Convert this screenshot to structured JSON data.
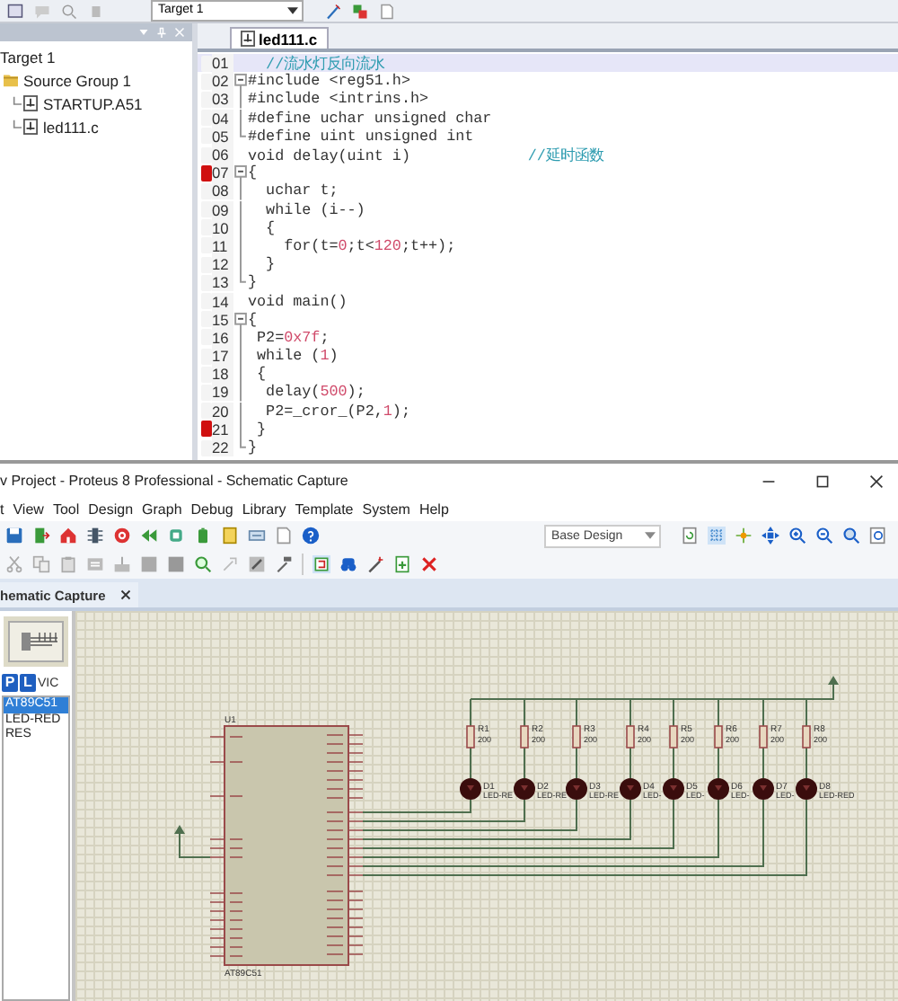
{
  "keil": {
    "target_select": "Target 1",
    "project_tree": [
      {
        "label": "Target 1",
        "children": [
          {
            "label": "Source Group 1",
            "kind": "folder",
            "children": [
              {
                "label": "STARTUP.A51",
                "kind": "file"
              },
              {
                "label": "led111.c",
                "kind": "file"
              }
            ]
          }
        ]
      }
    ],
    "editor": {
      "tab": "led111.c",
      "lines": [
        {
          "num": "01",
          "highlighted": true,
          "breakpoint": false,
          "kind": "plain",
          "segments": [
            {
              "kind": "comment",
              "text": "  //流水灯反向流水"
            }
          ]
        },
        {
          "num": "02",
          "highlighted": false,
          "breakpoint": false,
          "kind": "open",
          "segments": [
            {
              "kind": "code",
              "text": "#include <reg51.h>"
            }
          ]
        },
        {
          "num": "03",
          "highlighted": false,
          "breakpoint": false,
          "kind": "inner",
          "segments": [
            {
              "kind": "code",
              "text": "#include <intrins.h>"
            }
          ]
        },
        {
          "num": "04",
          "highlighted": false,
          "breakpoint": false,
          "kind": "inner",
          "segments": [
            {
              "kind": "code",
              "text": "#define uchar unsigned char"
            }
          ]
        },
        {
          "num": "05",
          "highlighted": false,
          "breakpoint": false,
          "kind": "close",
          "segments": [
            {
              "kind": "code",
              "text": "#define uint unsigned int"
            }
          ]
        },
        {
          "num": "06",
          "highlighted": false,
          "breakpoint": false,
          "kind": "plain",
          "segments": [
            {
              "kind": "code",
              "text": "void delay(uint i)             "
            },
            {
              "kind": "comment",
              "text": "//延时函数"
            }
          ]
        },
        {
          "num": "07",
          "highlighted": false,
          "breakpoint": true,
          "kind": "open",
          "segments": [
            {
              "kind": "code",
              "text": "{"
            }
          ]
        },
        {
          "num": "08",
          "highlighted": false,
          "breakpoint": false,
          "kind": "inner",
          "segments": [
            {
              "kind": "code",
              "text": "  uchar t;"
            }
          ]
        },
        {
          "num": "09",
          "highlighted": false,
          "breakpoint": false,
          "kind": "inner",
          "segments": [
            {
              "kind": "code",
              "text": "  while (i--)"
            }
          ]
        },
        {
          "num": "10",
          "highlighted": false,
          "breakpoint": false,
          "kind": "inner",
          "segments": [
            {
              "kind": "code",
              "text": "  {"
            }
          ]
        },
        {
          "num": "11",
          "highlighted": false,
          "breakpoint": false,
          "kind": "inner",
          "segments": [
            {
              "kind": "code",
              "text": "    for(t="
            },
            {
              "kind": "number",
              "text": "0"
            },
            {
              "kind": "code",
              "text": ";t<"
            },
            {
              "kind": "number",
              "text": "120"
            },
            {
              "kind": "code",
              "text": ";t++);"
            }
          ]
        },
        {
          "num": "12",
          "highlighted": false,
          "breakpoint": false,
          "kind": "inner",
          "segments": [
            {
              "kind": "code",
              "text": "  }"
            }
          ]
        },
        {
          "num": "13",
          "highlighted": false,
          "breakpoint": false,
          "kind": "close",
          "segments": [
            {
              "kind": "code",
              "text": "}"
            }
          ]
        },
        {
          "num": "14",
          "highlighted": false,
          "breakpoint": false,
          "kind": "plain",
          "segments": [
            {
              "kind": "code",
              "text": "void main()"
            }
          ]
        },
        {
          "num": "15",
          "highlighted": false,
          "breakpoint": false,
          "kind": "open",
          "segments": [
            {
              "kind": "code",
              "text": "{"
            }
          ]
        },
        {
          "num": "16",
          "highlighted": false,
          "breakpoint": false,
          "kind": "inner",
          "segments": [
            {
              "kind": "code",
              "text": " P2="
            },
            {
              "kind": "number",
              "text": "0x7f"
            },
            {
              "kind": "code",
              "text": ";"
            }
          ]
        },
        {
          "num": "17",
          "highlighted": false,
          "breakpoint": false,
          "kind": "inner",
          "segments": [
            {
              "kind": "code",
              "text": " while ("
            },
            {
              "kind": "number",
              "text": "1"
            },
            {
              "kind": "code",
              "text": ")"
            }
          ]
        },
        {
          "num": "18",
          "highlighted": false,
          "breakpoint": false,
          "kind": "inner",
          "segments": [
            {
              "kind": "code",
              "text": " {"
            }
          ]
        },
        {
          "num": "19",
          "highlighted": false,
          "breakpoint": false,
          "kind": "inner",
          "segments": [
            {
              "kind": "code",
              "text": "  delay("
            },
            {
              "kind": "number",
              "text": "500"
            },
            {
              "kind": "code",
              "text": ");"
            }
          ]
        },
        {
          "num": "20",
          "highlighted": false,
          "breakpoint": false,
          "kind": "inner",
          "segments": [
            {
              "kind": "code",
              "text": "  P2=_cror_(P2,"
            },
            {
              "kind": "number",
              "text": "1"
            },
            {
              "kind": "code",
              "text": ");"
            }
          ]
        },
        {
          "num": "21",
          "highlighted": false,
          "breakpoint": true,
          "kind": "inner",
          "segments": [
            {
              "kind": "code",
              "text": " }"
            }
          ]
        },
        {
          "num": "22",
          "highlighted": false,
          "breakpoint": false,
          "kind": "close",
          "segments": [
            {
              "kind": "code",
              "text": "}"
            }
          ]
        }
      ]
    }
  },
  "proteus": {
    "title": "v Project - Proteus 8 Professional - Schematic Capture",
    "menu": [
      "t",
      "View",
      "Tool",
      "Design",
      "Graph",
      "Debug",
      "Library",
      "Template",
      "System",
      "Help"
    ],
    "design_select": "Base Design",
    "tab": "hematic Capture",
    "picker": {
      "buttons": [
        "P",
        "L"
      ],
      "label": "VIC",
      "devices": [
        {
          "name": "AT89C51",
          "selected": true
        },
        {
          "name": "LED-RED",
          "selected": false
        },
        {
          "name": "RES",
          "selected": false
        }
      ]
    },
    "schematic": {
      "chip": {
        "ref": "U1",
        "part": "AT89C51"
      },
      "resistors": [
        {
          "ref": "R1",
          "value": "200"
        },
        {
          "ref": "R2",
          "value": "200"
        },
        {
          "ref": "R3",
          "value": "200"
        },
        {
          "ref": "R4",
          "value": "200"
        },
        {
          "ref": "R5",
          "value": "200"
        },
        {
          "ref": "R6",
          "value": "200"
        },
        {
          "ref": "R7",
          "value": "200"
        },
        {
          "ref": "R8",
          "value": "200"
        }
      ],
      "leds": [
        {
          "ref": "D1",
          "part": "LED-RE"
        },
        {
          "ref": "D2",
          "part": "LED-RE"
        },
        {
          "ref": "D3",
          "part": "LED-RE"
        },
        {
          "ref": "D4",
          "part": "LED-"
        },
        {
          "ref": "D5",
          "part": "LED-"
        },
        {
          "ref": "D6",
          "part": "LED-"
        },
        {
          "ref": "D7",
          "part": "LED-"
        },
        {
          "ref": "D8",
          "part": "LED-RED"
        }
      ]
    }
  }
}
